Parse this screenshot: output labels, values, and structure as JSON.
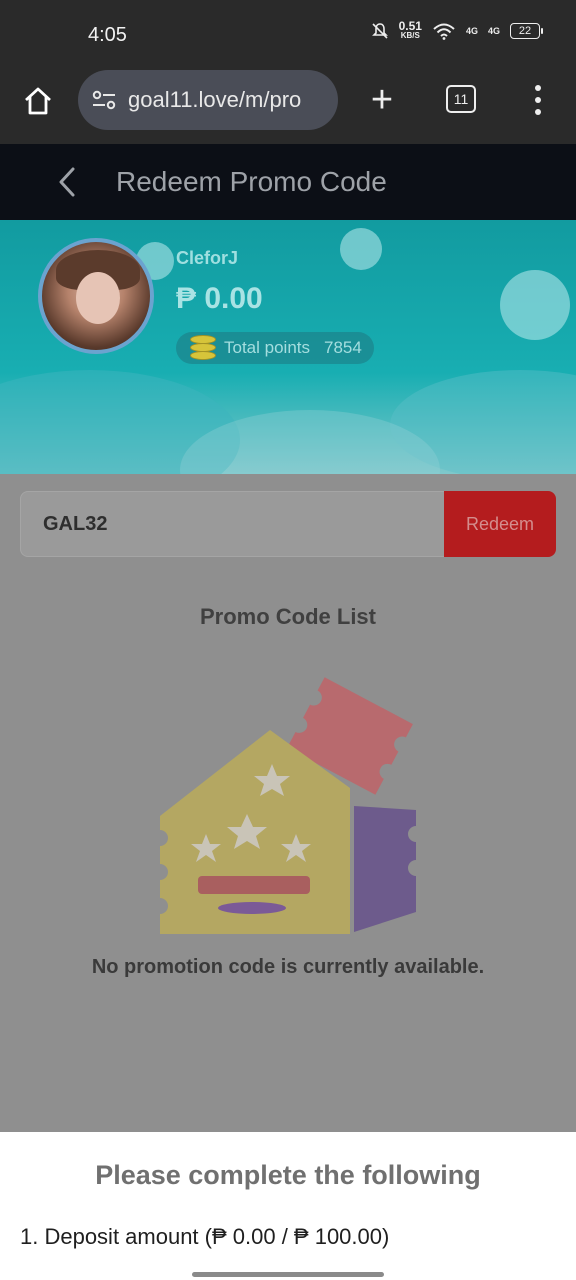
{
  "status_bar": {
    "time": "4:05",
    "net_speed_value": "0.51",
    "net_speed_unit": "KB/S",
    "signal_1": "4G",
    "signal_2": "4G",
    "battery": "22"
  },
  "browser": {
    "url": "goal11.love/m/pro",
    "tab_count": "11"
  },
  "header": {
    "title": "Redeem Promo Code"
  },
  "profile": {
    "username": "CleforJ",
    "balance": "₱ 0.00",
    "points_label": "Total points",
    "points_value": "7854"
  },
  "promo": {
    "input_value": "GAL32",
    "redeem_label": "Redeem"
  },
  "list": {
    "title": "Promo Code List",
    "empty_message": "No promotion code is currently available."
  },
  "sheet": {
    "title": "Please complete the following",
    "item_1": "1. Deposit amount (₱ 0.00 / ₱ 100.00)"
  },
  "colors": {
    "hero_teal": "#18aeb2",
    "redeem_red": "#b41c1e",
    "header_dark": "#0c0f16"
  }
}
